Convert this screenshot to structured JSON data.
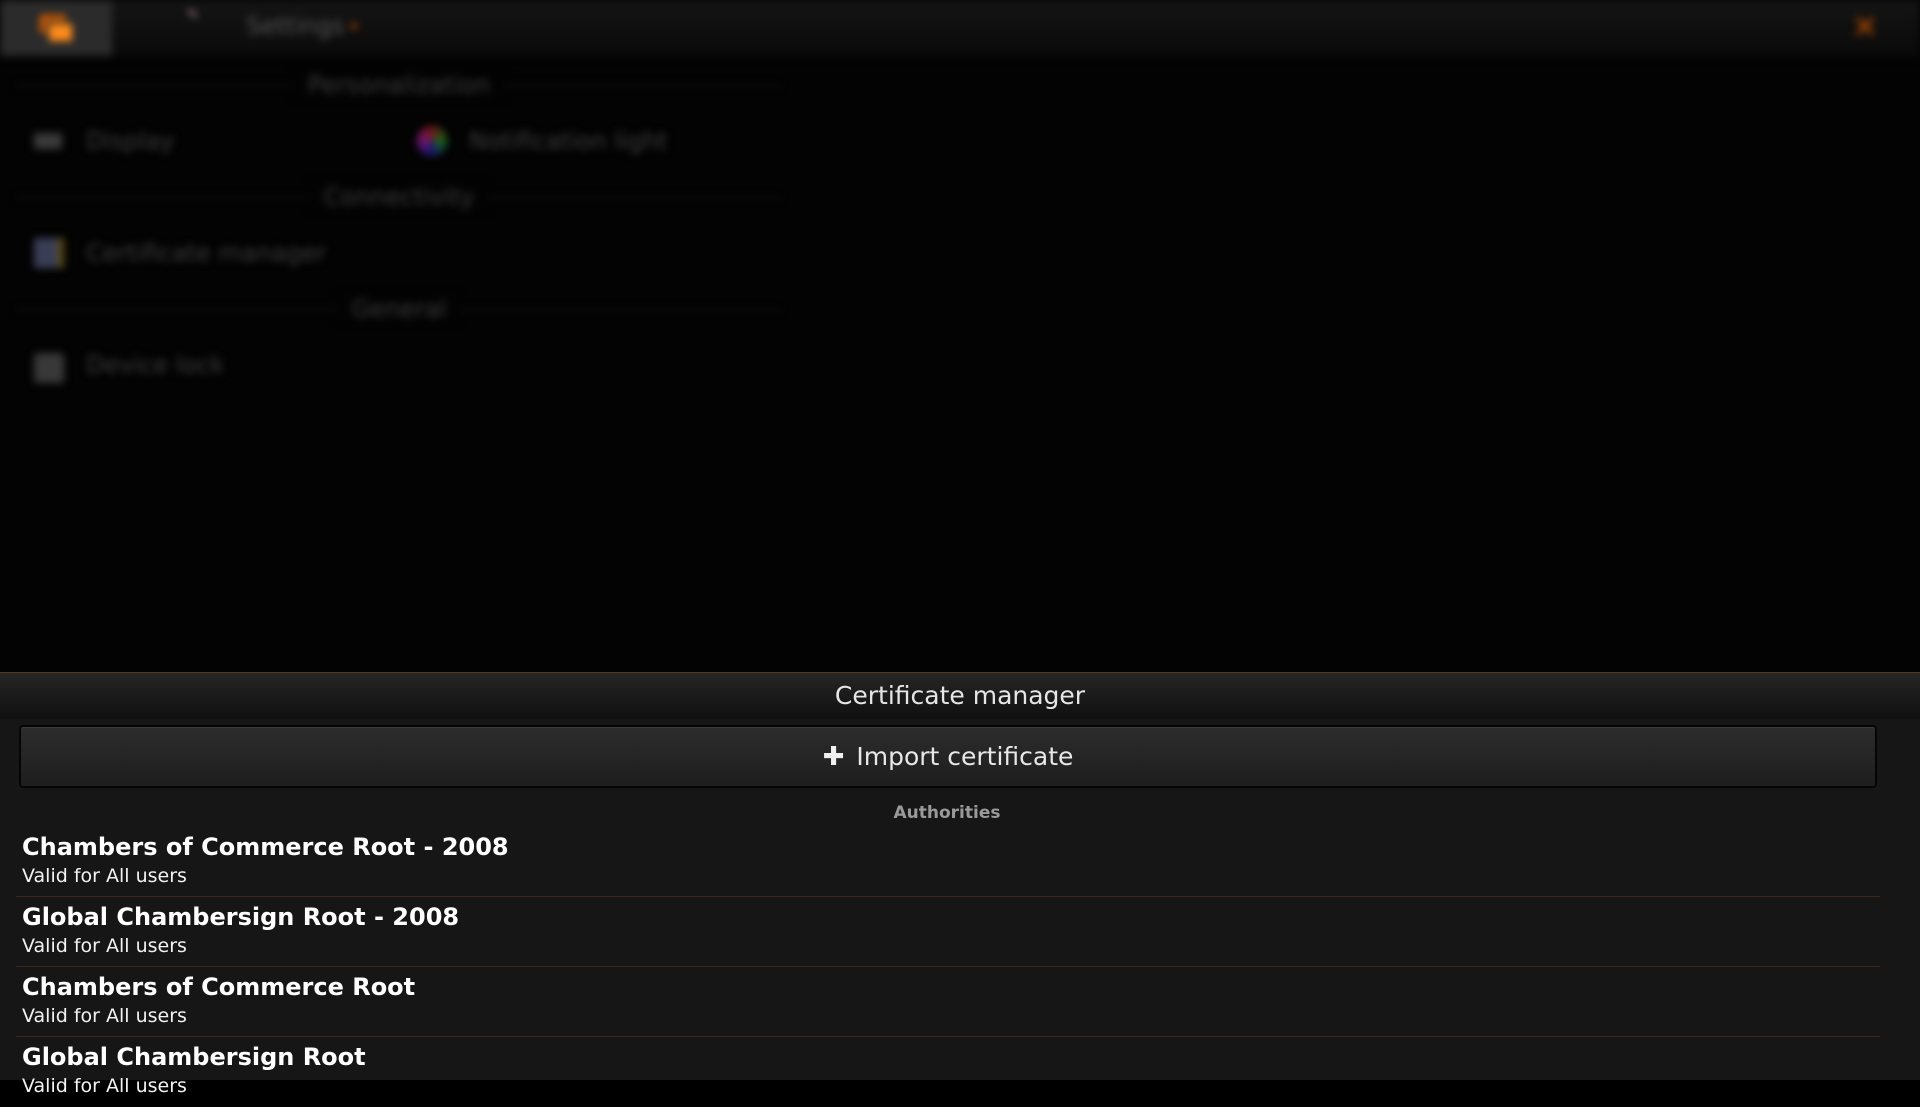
{
  "topbar": {
    "menu_icon": "app-windows-icon",
    "edit_icon": "pencil-icon",
    "title": "Settings",
    "dropdown_caret": "▾",
    "close_icon": "close-x-icon",
    "accent_color": "#ff8c1a"
  },
  "settings": {
    "sections": [
      {
        "label": "Personalization",
        "items": [
          {
            "label": "Display",
            "icon": "display-icon"
          },
          {
            "label": "Notification light",
            "icon": "color-wheel-icon"
          }
        ]
      },
      {
        "label": "Connectivity",
        "items": [
          {
            "label": "Certificate manager",
            "icon": "certificate-icon"
          }
        ]
      },
      {
        "label": "General",
        "items": [
          {
            "label": "Device lock",
            "icon": "lock-icon"
          }
        ]
      }
    ]
  },
  "dialog": {
    "title": "Certificate manager",
    "import_label": "Import certificate",
    "import_icon": "plus-icon",
    "list_heading": "Authorities",
    "certificates": [
      {
        "name": "Chambers of Commerce Root - 2008",
        "subtitle": "Valid for All users"
      },
      {
        "name": "Global Chambersign Root - 2008",
        "subtitle": "Valid for All users"
      },
      {
        "name": "Chambers of Commerce Root",
        "subtitle": "Valid for All users"
      },
      {
        "name": "Global Chambersign Root",
        "subtitle": "Valid for All users"
      }
    ]
  }
}
